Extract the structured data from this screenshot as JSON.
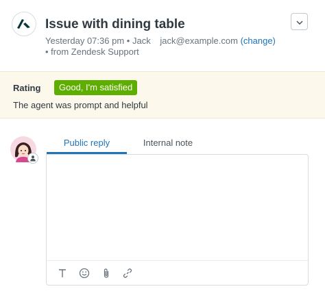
{
  "ticket": {
    "title": "Issue with dining table",
    "timestamp": "Yesterday 07:36 pm",
    "separator": "•",
    "requester": "Jack",
    "email": "jack@example.com",
    "change_label": "(change)",
    "source": "• from Zendesk Support",
    "logo_icon": "zendesk-logo-icon",
    "menu_icon": "chevron-down-icon"
  },
  "rating": {
    "label": "Rating",
    "badge": "Good, I'm satisfied",
    "badge_color": "#5eae00",
    "comment": "The agent was prompt and helpful"
  },
  "composer": {
    "avatar_icon": "agent-avatar",
    "tabs": [
      {
        "label": "Public reply",
        "active": true
      },
      {
        "label": "Internal note",
        "active": false
      }
    ],
    "toolbar_icons": [
      "text-format-icon",
      "emoji-icon",
      "attachment-icon",
      "link-icon"
    ],
    "accent_color": "#1f73b7"
  }
}
